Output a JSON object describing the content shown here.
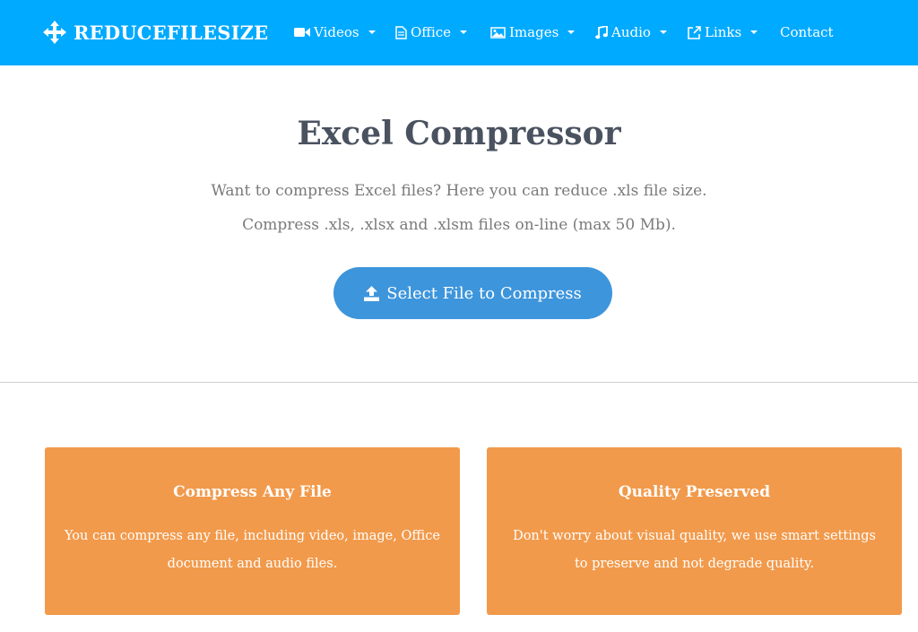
{
  "navbar": {
    "brand": "REDUCEFILESIZE",
    "background": "#00aaff",
    "items": [
      {
        "label": "Videos",
        "icon": "video-camera-icon",
        "dropdown": true
      },
      {
        "label": "Office",
        "icon": "document-icon",
        "dropdown": true
      },
      {
        "label": "Images",
        "icon": "image-icon",
        "dropdown": true
      },
      {
        "label": "Audio",
        "icon": "music-note-icon",
        "dropdown": true
      },
      {
        "label": "Links",
        "icon": "external-link-icon",
        "dropdown": true
      },
      {
        "label": "Contact",
        "icon": "",
        "dropdown": false
      }
    ]
  },
  "hero": {
    "title": "Excel Compressor",
    "line1": "Want to compress Excel files? Here you can reduce .xls file size.",
    "line2": "Compress .xls, .xlsx and .xlsm files on-line (max 50 Mb).",
    "button_label": "Select File to Compress",
    "button_icon": "upload-icon",
    "button_color": "#3d95dc"
  },
  "features": [
    {
      "title": "Compress Any File",
      "text": "You can compress any file, including video, image, Office document and audio files."
    },
    {
      "title": "Quality Preserved",
      "text": "Don't worry about visual quality, we use smart settings to preserve and not degrade quality."
    }
  ],
  "colors": {
    "card": "#f29a4b",
    "title": "#4a5260"
  }
}
